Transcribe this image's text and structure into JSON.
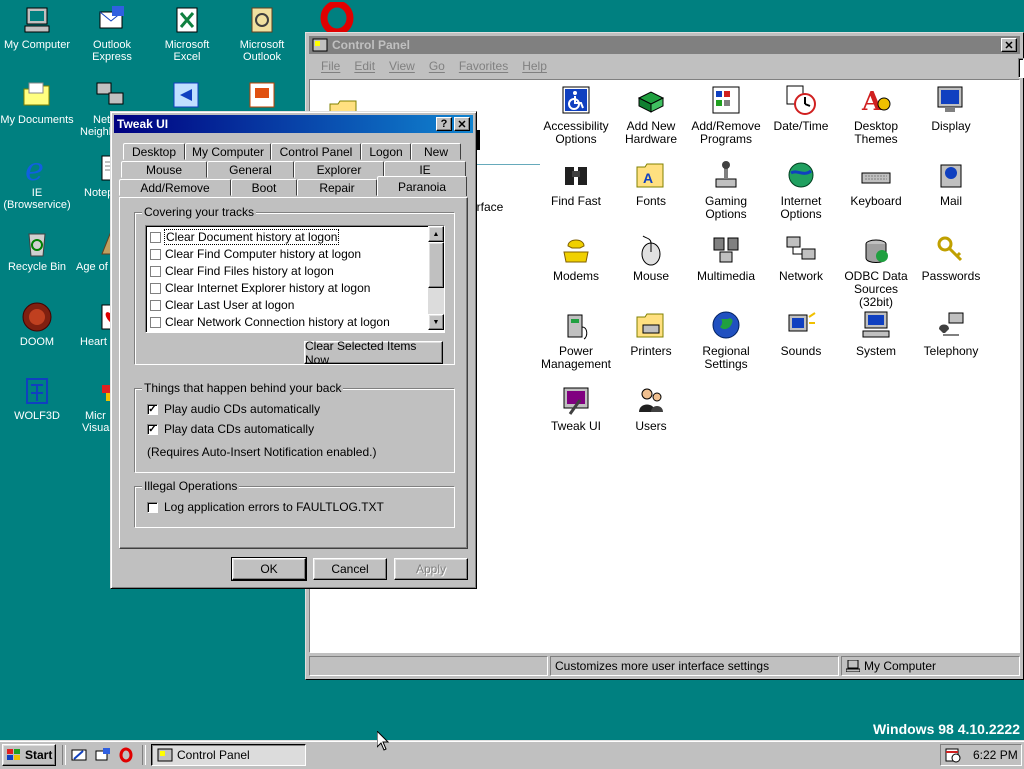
{
  "desktop": {
    "icons": [
      {
        "label": "My Computer"
      },
      {
        "label": "Outlook Express"
      },
      {
        "label": "Microsoft Excel"
      },
      {
        "label": "Microsoft Outlook"
      },
      {
        "label": "My Documents"
      },
      {
        "label": "Net"
      },
      {
        "label": "Neighb"
      },
      {
        "label": "IE (Browservice)"
      },
      {
        "label": "Notep"
      },
      {
        "label": "Recycle Bin"
      },
      {
        "label": "Age of"
      },
      {
        "label": "DOOM"
      },
      {
        "label": "Heart"
      },
      {
        "label": "WOLF3D"
      },
      {
        "label": "Micr"
      },
      {
        "label": "Visual"
      }
    ],
    "version_text": "Windows 98 4.10.2222"
  },
  "control_panel": {
    "title": "Control Panel",
    "menu": [
      "File",
      "Edit",
      "View",
      "Go",
      "Favorites",
      "Help"
    ],
    "partial_text": "erface",
    "items": [
      {
        "label": "Accessibility Options",
        "icon": "accessibility-icon"
      },
      {
        "label": "Add New Hardware",
        "icon": "hardware-icon"
      },
      {
        "label": "Add/Remove Programs",
        "icon": "programs-icon"
      },
      {
        "label": "Date/Time",
        "icon": "clock-icon"
      },
      {
        "label": "Desktop Themes",
        "icon": "themes-icon"
      },
      {
        "label": "Display",
        "icon": "display-icon"
      },
      {
        "label": "Find Fast",
        "icon": "binoculars-icon"
      },
      {
        "label": "Fonts",
        "icon": "fonts-icon"
      },
      {
        "label": "Gaming Options",
        "icon": "joystick-icon"
      },
      {
        "label": "Internet Options",
        "icon": "globe-icon"
      },
      {
        "label": "Keyboard",
        "icon": "keyboard-icon"
      },
      {
        "label": "Mail",
        "icon": "mail-icon"
      },
      {
        "label": "Modems",
        "icon": "modem-icon"
      },
      {
        "label": "Mouse",
        "icon": "mouse-icon"
      },
      {
        "label": "Multimedia",
        "icon": "multimedia-icon"
      },
      {
        "label": "Network",
        "icon": "network-icon"
      },
      {
        "label": "ODBC Data Sources (32bit)",
        "icon": "odbc-icon"
      },
      {
        "label": "Passwords",
        "icon": "keys-icon"
      },
      {
        "label": "Power Management",
        "icon": "power-icon"
      },
      {
        "label": "Printers",
        "icon": "printer-icon"
      },
      {
        "label": "Regional Settings",
        "icon": "regional-globe-icon"
      },
      {
        "label": "Sounds",
        "icon": "speaker-icon"
      },
      {
        "label": "System",
        "icon": "computer-icon"
      },
      {
        "label": "Telephony",
        "icon": "telephone-icon"
      },
      {
        "label": "Tweak UI",
        "icon": "tweakui-icon"
      },
      {
        "label": "Users",
        "icon": "users-icon"
      }
    ],
    "status": {
      "left": "",
      "middle": "Customizes more user interface settings",
      "right": "My Computer"
    }
  },
  "tweak_ui": {
    "title": "Tweak UI",
    "help_btn": "?",
    "close_btn": "✕",
    "tabs_row1": [
      "Desktop",
      "My Computer",
      "Control Panel",
      "Logon",
      "New"
    ],
    "tabs_row2": [
      "Mouse",
      "General",
      "Explorer",
      "IE"
    ],
    "tabs_row3": [
      "Add/Remove",
      "Boot",
      "Repair",
      "Paranoia"
    ],
    "active_tab": "Paranoia",
    "group1": {
      "legend": "Covering your tracks",
      "items": [
        {
          "label": "Clear Document history at logon",
          "checked": false,
          "selected": true
        },
        {
          "label": "Clear Find Computer history at logon",
          "checked": false
        },
        {
          "label": "Clear Find Files history at logon",
          "checked": false
        },
        {
          "label": "Clear Internet Explorer history at logon",
          "checked": false
        },
        {
          "label": "Clear Last User at logon",
          "checked": false
        },
        {
          "label": "Clear Network Connection history at logon",
          "checked": false
        }
      ],
      "clear_button": "Clear Selected Items Now"
    },
    "group2": {
      "legend": "Things that happen behind your back",
      "audio": {
        "label": "Play audio CDs automatically",
        "checked": true
      },
      "data": {
        "label": "Play data CDs automatically",
        "checked": true
      },
      "note": "(Requires Auto-Insert Notification enabled.)"
    },
    "group3": {
      "legend": "Illegal Operations",
      "faultlog": {
        "label": "Log application errors to FAULTLOG.TXT",
        "checked": false
      }
    },
    "buttons": {
      "ok": "OK",
      "cancel": "Cancel",
      "apply": "Apply"
    }
  },
  "taskbar": {
    "start": "Start",
    "task": "Control Panel",
    "clock": "6:22 PM"
  }
}
